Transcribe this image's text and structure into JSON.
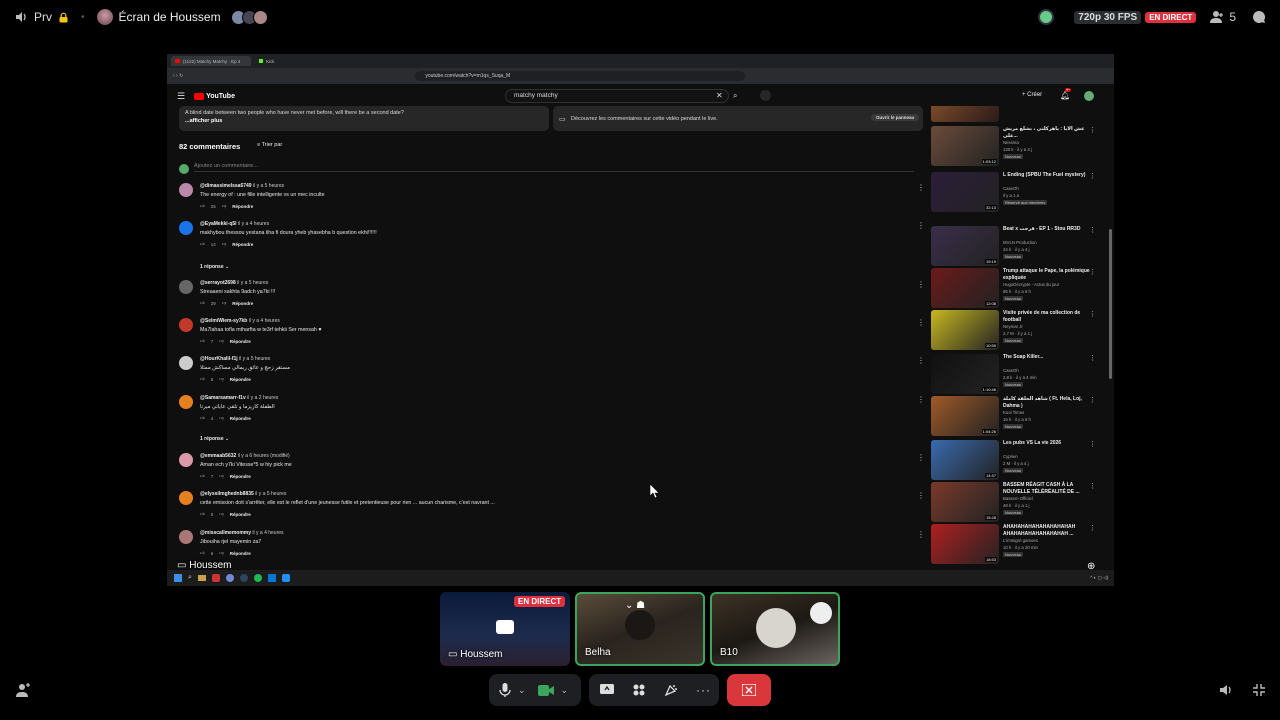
{
  "topbar": {
    "channel": "Prv",
    "screen_label": "Écran de Houssem",
    "quality": "720p 30 FPS",
    "live": "EN DIRECT",
    "viewers": "5"
  },
  "browser": {
    "tab1": "(1122) Matchy Matchy - Ep 4",
    "tab2": "Kick",
    "url": "youtube.com/watch?v=m1qs_Suqa_M"
  },
  "youtube": {
    "logo": "YouTube",
    "search_value": "matchy matchy",
    "create_label": "Créer",
    "notif_count": "9+",
    "desc_line1": "A blind date between two people who have never met before, will there be a second date?",
    "desc_more": "...afficher plus",
    "live_chat_text": "Découvrez les commentaires sur cette vidéo pendant le live.",
    "live_chat_button": "Ouvrir le panneau",
    "comments_count": "82 commentaires",
    "sort_label": "Trier par",
    "add_comment_placeholder": "Ajoutez un commentaire...",
    "reply_label": "Répondre",
    "comments": [
      {
        "author": "@dimassimelssa6749",
        "time": "il y a 5 heures",
        "text": "The energy of : une fille intelligente vs un mec inculte",
        "likes": "25"
      },
      {
        "author": "@EyaMekki-q5l",
        "time": "il y a 4 heures",
        "text": "makhybou thessou yestana liha fi doura yheb yhasebha b question ekhi!!!!!!",
        "likes": "14"
      },
      {
        "author": "@serrayot2698",
        "time": "il y a 5 heures",
        "text": "Streaaeni sakhta 9adch ya7ki !!!",
        "likes": "29"
      },
      {
        "author": "@SelmiWiem-sy7kb",
        "time": "il y a 4 heures",
        "text": "Ma7lahaa tofla mtharfta w te3rf tehkii Ser mensah ♥",
        "likes": "7"
      },
      {
        "author": "@HourKhalil-f1j",
        "time": "il y a 5 heures",
        "text": "مستقر زحچ و عائق ريمالي مساكش ممثلا",
        "likes": "6"
      },
      {
        "author": "@Samarsamarr-f1v",
        "time": "il y a 2 heures",
        "text": "الطفلة كاريزما و تلقي عاياتي ميرتا",
        "likes": "4"
      },
      {
        "author": "@emmaab5632",
        "time": "il y a 6 heures (modifié)",
        "text": "Aman ech y7ki Vitesse*5 w hiy pick me",
        "likes": "7"
      },
      {
        "author": "@elyssilmghednb8835",
        "time": "il y a 5 heures",
        "text": "cette emission doit s'arrêter, elle est le reflet d'une jeunesse futile et pretentieuse pour rien ... aucun charisme, c'est navrant ...",
        "likes": "5"
      },
      {
        "author": "@misscallmemommy",
        "time": "il y a 4 heures",
        "text": "Jibouiha rjel mayemin za7",
        "likes": "6"
      }
    ],
    "reply_toggle_1": "1 réponse",
    "reply_toggle_2": "1 réponse",
    "sidebar": [
      {
        "title": "عش الايا : ياهركلتي ، بشلع مريش على...",
        "channel": "Nessma",
        "meta": "130 k · il y a 4 j",
        "badge": "Nouveau",
        "dur": "1:03:12"
      },
      {
        "title": "L Ending (SPBU The Fuel mystery)",
        "channel": "CaseOh",
        "meta": "il y a 1 a",
        "badge": "Réservé aux membres",
        "dur": "32:13"
      },
      {
        "title": "Beat x قرجت - EP 1 - Stou RR3D",
        "channel": "MVLN Production",
        "meta": "34 k · il y a 4 j",
        "badge": "Nouveau",
        "dur": "19:19"
      },
      {
        "title": "Trump attaque le Pape, la polémique expliquée",
        "channel": "HugoDécrypte - Actus du jour",
        "meta": "86 k · il y a 6 h",
        "badge": "Nouveau",
        "dur": "12:08"
      },
      {
        "title": "Visite privée de ma collection de football",
        "channel": "Neymar Jr",
        "meta": "2,7 M · il y a 1 j",
        "badge": "Nouveau",
        "dur": "10:59"
      },
      {
        "title": "The Soap Killer...",
        "channel": "CaseOh",
        "meta": "2,8 k · il y a 4 min",
        "badge": "Nouveau",
        "dur": "1:10:46"
      },
      {
        "title": "شاهد الحلقة كاملة ( Ft. Hela, Loj, Dahma )",
        "channel": "Kool Times",
        "meta": "16 k · il y a 6 h",
        "badge": "Nouveau",
        "dur": "1:04:26"
      },
      {
        "title": "Les pubs VS La vie 2026",
        "channel": "Cyprien",
        "meta": "2 M · il y a 4 j",
        "badge": "Nouveau",
        "dur": "14:37"
      },
      {
        "title": "BASSEM RÉAGIT CASH À LA NOUVELLE TÉLÉRÉALITÉ DE ...",
        "channel": "Bassem Officiel",
        "meta": "48 k · il y a 1 j",
        "badge": "Nouveau",
        "dur": "15:28"
      },
      {
        "title": "AHAHAHAHAHAHAHAHAHAH AHAHAHAHAHAHAHAHAH ...",
        "channel": "L'immigré gamoes",
        "meta": "10 k · il y a 20 min",
        "badge": "Nouveau",
        "dur": "18:53"
      }
    ],
    "streamer_label": "Houssem"
  },
  "tiles": [
    {
      "name": "Houssem",
      "badge": "EN DIRECT"
    },
    {
      "name": "Belha"
    },
    {
      "name": "B10"
    }
  ],
  "colors": {
    "live_red": "#e0303d",
    "speaking_green": "#3ba55d",
    "leave_red": "#da373c"
  }
}
